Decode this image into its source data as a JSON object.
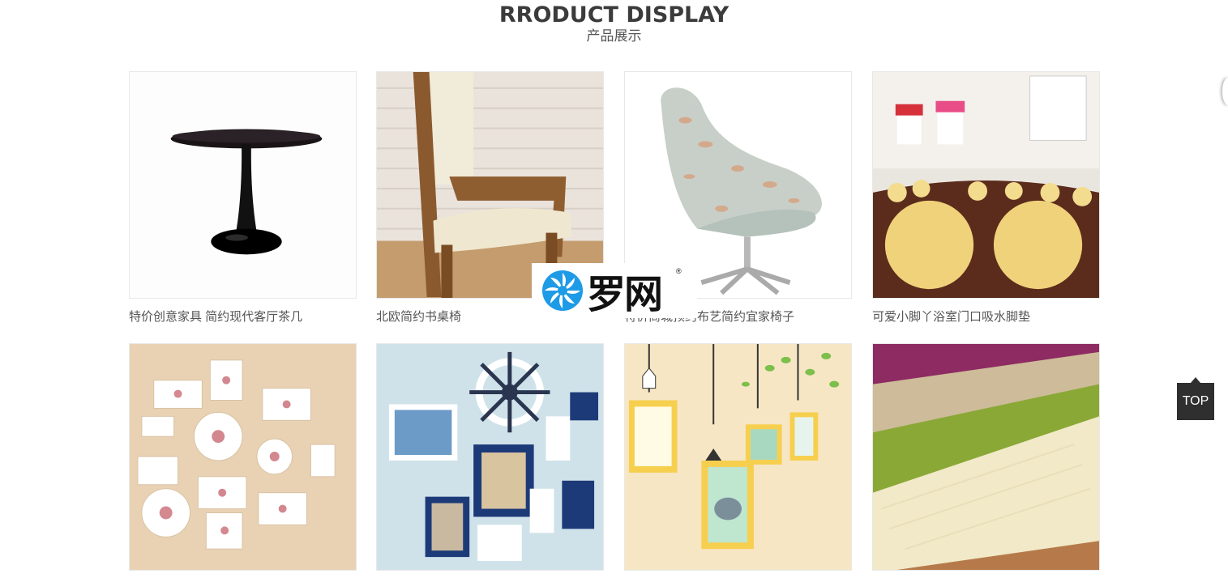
{
  "section": {
    "title_en": "RRODUCT DISPLAY",
    "title_cn": "产品展示"
  },
  "products": [
    {
      "caption": "特价创意家具 简约现代客厅茶几",
      "image": "round-table"
    },
    {
      "caption": "北欧简约书桌椅",
      "image": "wood-chair"
    },
    {
      "caption": "特价商城预约布艺简约宜家椅子",
      "image": "swan-chair"
    },
    {
      "caption": "可爱小脚丫浴室门口吸水脚垫",
      "image": "footprint-mat"
    },
    {
      "caption": "",
      "image": "photo-wall-floral"
    },
    {
      "caption": "",
      "image": "photo-wall-nautical"
    },
    {
      "caption": "",
      "image": "photo-wall-cartoon"
    },
    {
      "caption": "",
      "image": "plush-rugs"
    }
  ],
  "watermark": {
    "text": "罗网",
    "icon": "logo-icon"
  },
  "back_to_top": {
    "label": "TOP"
  },
  "colors": {
    "title": "#3b3b3b",
    "caption": "#555555",
    "top_button": "#2f2f2f"
  }
}
